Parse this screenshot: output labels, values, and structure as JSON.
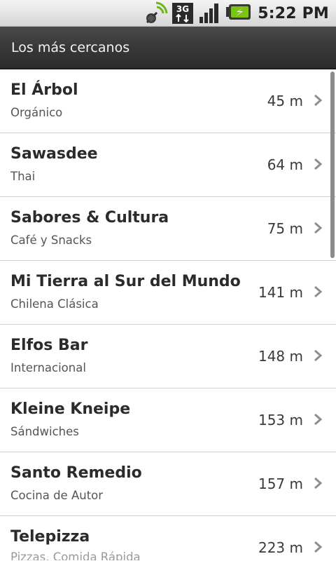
{
  "status_bar": {
    "time": "5:22 PM",
    "icons": [
      "location-satellite-icon",
      "3g-data-icon",
      "signal-strength-icon",
      "battery-charging-icon"
    ],
    "network_label": "3G"
  },
  "title_bar": {
    "title": "Los más cercanos"
  },
  "restaurants": [
    {
      "name": "El Árbol",
      "category": "Orgánico",
      "distance": "45 m"
    },
    {
      "name": "Sawasdee",
      "category": "Thai",
      "distance": "64 m"
    },
    {
      "name": "Sabores & Cultura",
      "category": "Café y Snacks",
      "distance": "75 m"
    },
    {
      "name": "Mi Tierra al Sur del Mundo",
      "category": "Chilena Clásica",
      "distance": "141 m"
    },
    {
      "name": "Elfos Bar",
      "category": "Internacional",
      "distance": "148 m"
    },
    {
      "name": "Kleine Kneipe",
      "category": "Sándwiches",
      "distance": "153 m"
    },
    {
      "name": "Santo Remedio",
      "category": "Cocina de Autor",
      "distance": "157 m"
    },
    {
      "name": "Telepizza",
      "category": "Pizzas, Comida Rápida",
      "distance": "223 m"
    }
  ],
  "colors": {
    "title_bar": "#383838",
    "status_bar": "#e0e0e0",
    "battery": "#7cc414",
    "divider": "#cfcfcf"
  }
}
